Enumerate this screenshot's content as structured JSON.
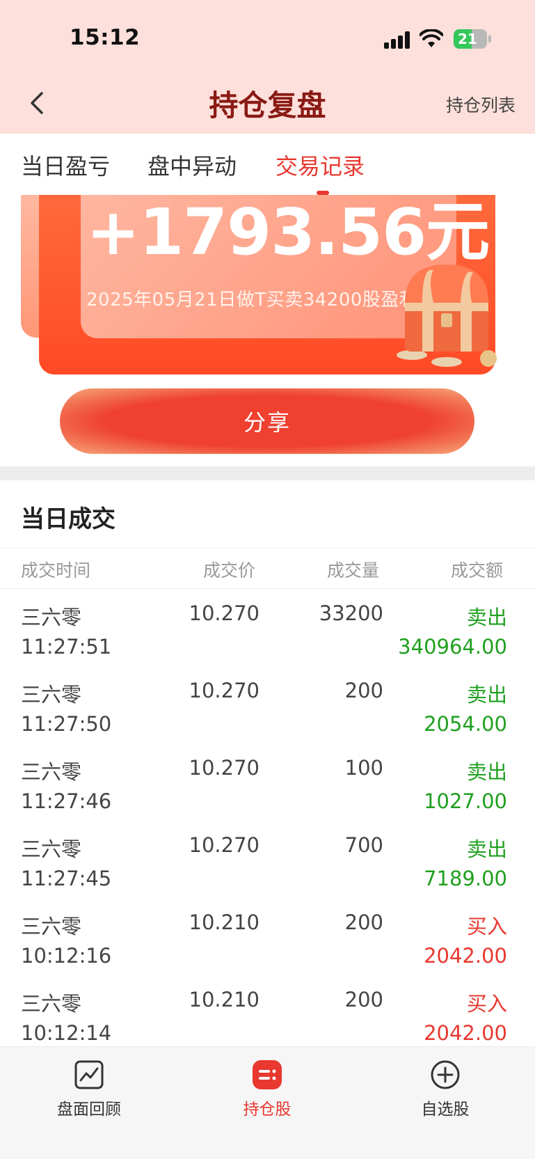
{
  "status_bar": {
    "time": "15:12",
    "battery": "21"
  },
  "nav": {
    "title": "持仓复盘",
    "right_label": "持仓列表"
  },
  "tabs": [
    {
      "label": "当日盈亏",
      "active": false
    },
    {
      "label": "盘中异动",
      "active": false
    },
    {
      "label": "交易记录",
      "active": true
    }
  ],
  "banner": {
    "amount": "+1793.56元",
    "subtitle": "2025年05月21日做T买卖34200股盈利"
  },
  "share_button": "分享",
  "section": {
    "title": "当日成交",
    "columns": [
      "成交时间",
      "成交价",
      "成交量",
      "成交额"
    ]
  },
  "trades": [
    {
      "name": "三六零",
      "time": "11:27:51",
      "price": "10.270",
      "volume": "33200",
      "side": "卖出",
      "amount": "340964.00",
      "type": "sell"
    },
    {
      "name": "三六零",
      "time": "11:27:50",
      "price": "10.270",
      "volume": "200",
      "side": "卖出",
      "amount": "2054.00",
      "type": "sell"
    },
    {
      "name": "三六零",
      "time": "11:27:46",
      "price": "10.270",
      "volume": "100",
      "side": "卖出",
      "amount": "1027.00",
      "type": "sell"
    },
    {
      "name": "三六零",
      "time": "11:27:45",
      "price": "10.270",
      "volume": "700",
      "side": "卖出",
      "amount": "7189.00",
      "type": "sell"
    },
    {
      "name": "三六零",
      "time": "10:12:16",
      "price": "10.210",
      "volume": "200",
      "side": "买入",
      "amount": "2042.00",
      "type": "buy"
    },
    {
      "name": "三六零",
      "time": "10:12:14",
      "price": "10.210",
      "volume": "200",
      "side": "买入",
      "amount": "2042.00",
      "type": "buy"
    }
  ],
  "bottom_nav": [
    {
      "label": "盘面回顾",
      "icon": "chart-review-icon",
      "active": false
    },
    {
      "label": "持仓股",
      "icon": "holdings-icon",
      "active": true
    },
    {
      "label": "自选股",
      "icon": "add-circle-icon",
      "active": false
    }
  ],
  "colors": {
    "accent": "#e8382f",
    "sell": "#1fa01f",
    "buy": "#e8382f",
    "header_bg": "#fde0db"
  }
}
